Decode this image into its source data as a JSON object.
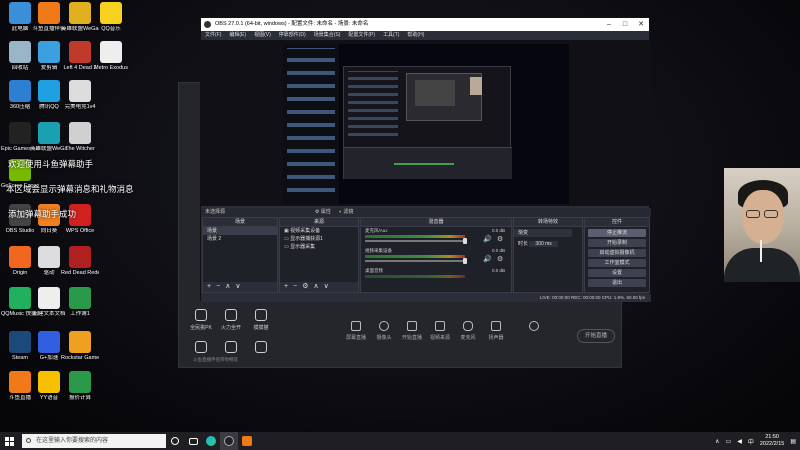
{
  "desktop_icons": [
    {
      "label": "此电脑",
      "color": "#3a8fd8"
    },
    {
      "label": "斗鱼直播伴侣",
      "color": "#f07a1a"
    },
    {
      "label": "英雄联盟WeGame",
      "color": "#e0b020"
    },
    {
      "label": "QQ音乐",
      "color": "#f6d21f"
    },
    {
      "label": "回收站",
      "color": "#9bb5c8"
    },
    {
      "label": "爱剪辑",
      "color": "#3aa0e0"
    },
    {
      "label": "Left 4 Dead 2",
      "color": "#c0392b"
    },
    {
      "label": "Metro Exodus",
      "color": "#eeeeee"
    },
    {
      "label": "360压缩",
      "color": "#2d7fd0"
    },
    {
      "label": "腾讯QQ",
      "color": "#20a0e0"
    },
    {
      "label": "完美电竞1v4",
      "color": "#dddddd"
    },
    {
      "label": "",
      "color": ""
    },
    {
      "label": "Epic Games Launcher",
      "color": "#222222"
    },
    {
      "label": "英雄联盟WeGame版",
      "color": "#1aa0b0"
    },
    {
      "label": "The Witcher",
      "color": "#d0d0d0"
    },
    {
      "label": "",
      "color": ""
    },
    {
      "label": "GeForce Experience",
      "color": "#76b900"
    },
    {
      "label": "",
      "color": ""
    },
    {
      "label": "",
      "color": ""
    },
    {
      "label": "",
      "color": ""
    },
    {
      "label": "OBS Studio",
      "color": "#444444"
    },
    {
      "label": "向日葵",
      "color": "#f08020"
    },
    {
      "label": "WPS Office",
      "color": "#d02020"
    },
    {
      "label": "",
      "color": ""
    },
    {
      "label": "Origin",
      "color": "#f06820"
    },
    {
      "label": "驱动",
      "color": "#dddddd"
    },
    {
      "label": "Red Dead Redempti...",
      "color": "#b02020"
    },
    {
      "label": "",
      "color": ""
    },
    {
      "label": "QQMusic 快捷方式",
      "color": "#20b060"
    },
    {
      "label": "新建文本文档",
      "color": "#eeeeee"
    },
    {
      "label": "工作簿1",
      "color": "#2a9a4a"
    },
    {
      "label": "",
      "color": ""
    },
    {
      "label": "Steam",
      "color": "#1b4a7a"
    },
    {
      "label": "G+加速",
      "color": "#3060e0"
    },
    {
      "label": "Rockstar Games...",
      "color": "#f0a020"
    },
    {
      "label": "",
      "color": ""
    },
    {
      "label": "斗鱼直播",
      "color": "#f07a1a"
    },
    {
      "label": "YY语音",
      "color": "#f6c000"
    },
    {
      "label": "报价计算",
      "color": "#2a9a4a"
    },
    {
      "label": "",
      "color": ""
    }
  ],
  "overlay_messages": {
    "welcome": "欢迎使用斗鱼弹幕助手",
    "notice": "本区域会显示弹幕消息和礼物消息",
    "success": "添加弹幕助手成功"
  },
  "bg_app": {
    "left_buttons": [
      "全民挑PK",
      "火力全开",
      "摸摸猫",
      "",
      "",
      ""
    ],
    "toolbar": [
      "屏幕直播",
      "摄像头",
      "开始直播",
      "视频来源",
      "麦克风",
      "扬声器",
      ""
    ],
    "start_button": "开始直播",
    "status": "斗鱼直播伴侣带你畅玩"
  },
  "obs": {
    "title": "OBS 27.0.1 (64-bit, windows) - 配置文件: 未命名 - 场景: 未命名",
    "menu": [
      "文件(F)",
      "编辑(E)",
      "视图(V)",
      "停靠部件(D)",
      "场景集合(S)",
      "配置文件(P)",
      "工具(T)",
      "帮助(H)"
    ],
    "source_bar": {
      "label": "未选择源",
      "props": "属性",
      "filters": "滤镜"
    },
    "docks": {
      "scenes": {
        "title": "场景",
        "items": [
          "场景",
          "场景 2"
        ]
      },
      "sources": {
        "title": "来源",
        "items": [
          "视频采集设备",
          "显示器捕获源1",
          "显示器采集"
        ]
      },
      "mixer": {
        "title": "混音器",
        "channels": [
          {
            "name": "麦克风/Aux",
            "db": "0.0 dB"
          },
          {
            "name": "视频采集设备",
            "db": "0.0 dB"
          },
          {
            "name": "桌面音频",
            "db": "0.0 dB"
          }
        ]
      },
      "transitions": {
        "title": "转场特效",
        "type": "渐变",
        "duration_label": "时长",
        "duration": "300 ms"
      },
      "controls": {
        "title": "控件",
        "buttons": [
          "停止推流",
          "开始录制",
          "启动虚拟摄像机",
          "工作室模式",
          "设置",
          "退出"
        ]
      }
    },
    "status": "LIVE: 00:00:00  REC: 00:00:00  CPU: 1.9%, 60.00 fps"
  },
  "taskbar": {
    "search_placeholder": "在这里输入你要搜索的内容",
    "time": "21:50",
    "date": "2022/2/15",
    "ime": "中"
  }
}
